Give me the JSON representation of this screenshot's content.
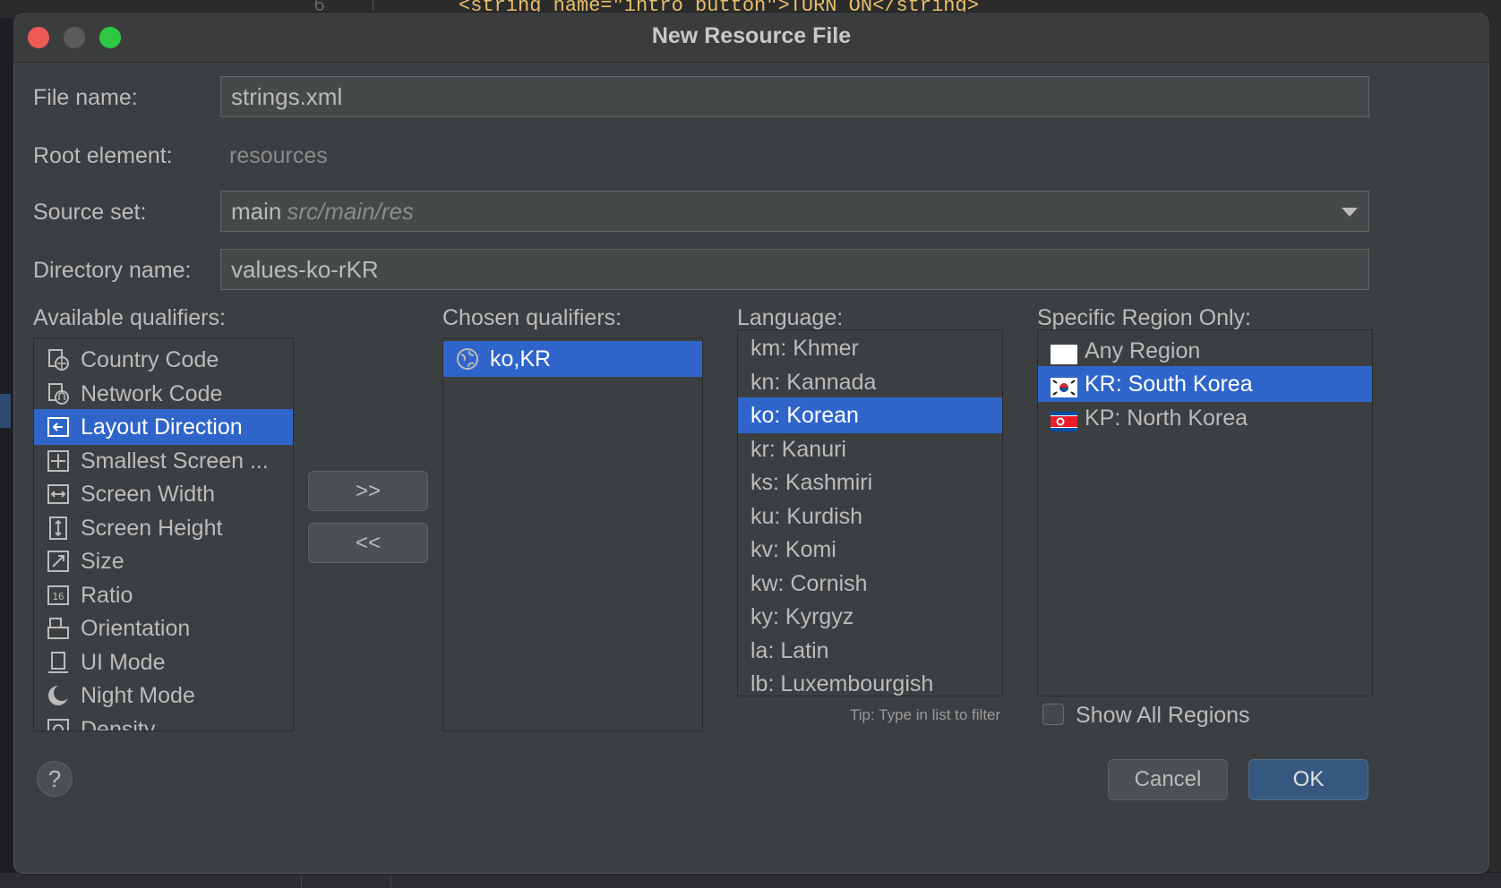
{
  "background": {
    "code_line_number": "6",
    "code_line": "<string name=\"intro_button\">TURN ON</string>"
  },
  "dialog": {
    "title": "New Resource File",
    "file_name_label": "File name:",
    "file_name_value": "strings.xml",
    "root_element_label": "Root element:",
    "root_element_value": "resources",
    "source_set_label": "Source set:",
    "source_set_value": "main",
    "source_set_path": "src/main/res",
    "directory_name_label": "Directory name:",
    "directory_name_value": "values-ko-rKR",
    "available_qualifiers_label": "Available qualifiers:",
    "chosen_qualifiers_label": "Chosen qualifiers:",
    "language_label": "Language:",
    "region_label": "Specific Region Only:",
    "available_qualifiers": [
      {
        "label": "Country Code",
        "icon": "country-code-icon"
      },
      {
        "label": "Network Code",
        "icon": "network-code-icon"
      },
      {
        "label": "Layout Direction",
        "icon": "layout-direction-icon",
        "selected": true
      },
      {
        "label": "Smallest Screen ...",
        "icon": "smallest-screen-icon"
      },
      {
        "label": "Screen Width",
        "icon": "screen-width-icon"
      },
      {
        "label": "Screen Height",
        "icon": "screen-height-icon"
      },
      {
        "label": "Size",
        "icon": "size-icon"
      },
      {
        "label": "Ratio",
        "icon": "ratio-icon"
      },
      {
        "label": "Orientation",
        "icon": "orientation-icon"
      },
      {
        "label": "UI Mode",
        "icon": "ui-mode-icon"
      },
      {
        "label": "Night Mode",
        "icon": "night-mode-icon"
      },
      {
        "label": "Density",
        "icon": "density-icon"
      }
    ],
    "chosen_qualifiers": [
      {
        "label": "ko,KR",
        "icon": "globe-icon",
        "selected": true
      }
    ],
    "add_button": ">>",
    "remove_button": "<<",
    "languages": [
      "km: Khmer",
      "kn: Kannada",
      "ko: Korean",
      "kr: Kanuri",
      "ks: Kashmiri",
      "ku: Kurdish",
      "kv: Komi",
      "kw: Cornish",
      "ky: Kyrgyz",
      "la: Latin",
      "lb: Luxembourgish"
    ],
    "selected_language": "ko: Korean",
    "regions": [
      {
        "label": "Any Region",
        "flag": "blank-flag-icon"
      },
      {
        "label": "KR: South Korea",
        "flag": "south-korea-flag-icon",
        "selected": true
      },
      {
        "label": "KP: North Korea",
        "flag": "north-korea-flag-icon"
      }
    ],
    "tip": "Tip: Type in list to filter",
    "show_all_regions_label": "Show All Regions",
    "show_all_regions_checked": false,
    "help_label": "?",
    "cancel_label": "Cancel",
    "ok_label": "OK"
  },
  "colors": {
    "selection": "#2f65ca",
    "dialog_bg": "#3c3f41",
    "ok_button": "#365880"
  }
}
